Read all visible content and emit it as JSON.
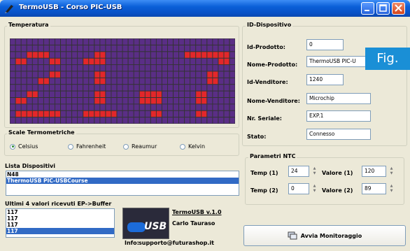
{
  "window": {
    "title": "TermoUSB - Corso PIC-USB"
  },
  "temperature": {
    "label": "Temperatura",
    "display": "21,7"
  },
  "scales": {
    "label": "Scale Termometriche",
    "options": [
      "Celsius",
      "Fahrenheit",
      "Reaumur",
      "Kelvin"
    ],
    "selected": "Celsius"
  },
  "devices": {
    "label": "Lista Dispositivi",
    "items": [
      "N48",
      "ThermoUSB PIC-USBCourse"
    ],
    "selected_index": 1
  },
  "buffer": {
    "label": "Ultimi 4 valori ricevuti EP->Buffer",
    "items": [
      "117",
      "117",
      "117",
      "117"
    ],
    "selected_index": 3
  },
  "about": {
    "app": "TermoUSB v.1.0",
    "author": "Carlo Tauraso",
    "info_label": "Info:",
    "email": "supporto@futurashop.it",
    "logo_text": "USB"
  },
  "device_id": {
    "label": "ID-Dispositivo",
    "fields": [
      {
        "label": "Id-Prodotto:",
        "value": "0"
      },
      {
        "label": "Nome-Prodotto:",
        "value": "ThermoUSB PIC-U"
      },
      {
        "label": "Id-Venditore:",
        "value": "1240"
      },
      {
        "label": "Nome-Venditore:",
        "value": "Microchip"
      },
      {
        "label": "Nr. Seriale:",
        "value": "EXP.1"
      },
      {
        "label": "Stato:",
        "value": "Connesso"
      }
    ]
  },
  "ntc": {
    "label": "Parametri NTC",
    "temp1_label": "Temp (1)",
    "temp1": "24",
    "val1_label": "Valore (1)",
    "val1": "120",
    "temp2_label": "Temp (2)",
    "temp2": "0",
    "val2_label": "Valore (2)",
    "val2": "89"
  },
  "monitor_button": {
    "label": "Avvia Monitoraggio"
  },
  "figure_badge": "Fig.",
  "colors": {
    "led_bg": "#5a2e86",
    "led_on": "#e3272a",
    "titlebar": "#0a5fd8",
    "selection": "#316ac5"
  }
}
